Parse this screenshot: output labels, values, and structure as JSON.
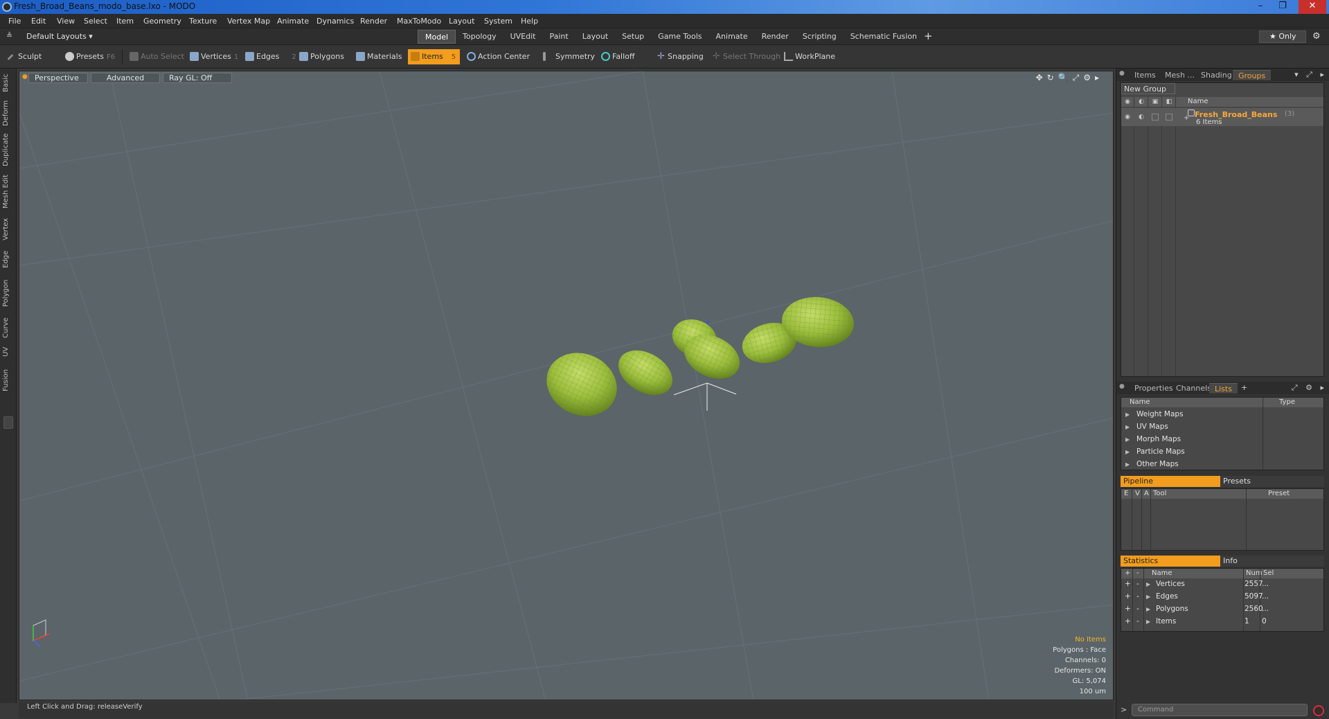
{
  "window": {
    "title": "Fresh_Broad_Beans_modo_base.lxo - MODO",
    "minimize": "–",
    "maximize": "❐",
    "close": "✕"
  },
  "menu": [
    "File",
    "Edit",
    "View",
    "Select",
    "Item",
    "Geometry",
    "Texture",
    "Vertex Map",
    "Animate",
    "Dynamics",
    "Render",
    "MaxToModo",
    "Layout",
    "System",
    "Help"
  ],
  "layoutbar": {
    "layout_label": "Default Layouts ▾",
    "tabs": [
      "Model",
      "Topology",
      "UVEdit",
      "Paint",
      "Layout",
      "Setup",
      "Game Tools",
      "Animate",
      "Render",
      "Scripting",
      "Schematic Fusion"
    ],
    "active_tab": "Model",
    "add": "+",
    "only_label": "★  Only",
    "settings": "⚙"
  },
  "toolbar": {
    "sculpt": "Sculpt",
    "presets": "Presets",
    "presets_key": "F6",
    "auto_select": "Auto Select",
    "vertices": "Vertices",
    "vertices_key": "1",
    "edges": "Edges",
    "edges_key": "2",
    "polygons": "Polygons",
    "materials": "Materials",
    "items": "Items",
    "items_key": "5",
    "action_center": "Action Center",
    "symmetry": "Symmetry",
    "falloff": "Falloff",
    "snapping": "Snapping",
    "select_through": "Select Through",
    "workplane": "WorkPlane"
  },
  "left_tabs": [
    "Basic",
    "Deform",
    "Duplicate",
    "Mesh Edit",
    "Vertex",
    "Edge",
    "Polygon",
    "Curve",
    "UV",
    "Fusion"
  ],
  "viewport": {
    "view": "Perspective",
    "shading": "Advanced",
    "raygl": "Ray GL: Off",
    "icons": "✥↻🔍⤢⚙▸",
    "info": {
      "selection": "No Items",
      "polygons": "Polygons : Face",
      "channels": "Channels: 0",
      "deformers": "Deformers: ON",
      "gl": "GL: 5,074",
      "scale": "100 um"
    }
  },
  "status": {
    "hint": "Left Click and Drag:   releaseVerify"
  },
  "right_panel": {
    "top_tabs": [
      "Items",
      "Mesh ...",
      "Shading",
      "Groups"
    ],
    "top_active": "Groups",
    "new_group": "New Group",
    "name_col": "Name",
    "group": {
      "name": "Fresh_Broad_Beans",
      "suffix": "(3)",
      "count": "6 Items"
    },
    "mid_tabs": [
      "Properties",
      "Channels",
      "Lists"
    ],
    "mid_active": "Lists",
    "lists_cols": {
      "name": "Name",
      "type": "Type"
    },
    "lists": [
      "Weight Maps",
      "UV Maps",
      "Morph Maps",
      "Particle Maps",
      "Other Maps"
    ],
    "pipeline": {
      "tab1": "Pipeline",
      "tab2": "Presets",
      "cols": [
        "E",
        "V",
        "A",
        "Tool",
        "Preset"
      ]
    },
    "statistics": {
      "tab1": "Statistics",
      "tab2": "Info",
      "cols": {
        "plus": "+",
        "minus": "-",
        "name": "Name",
        "num": "Num",
        "sel": "Sel"
      },
      "rows": [
        {
          "name": "Vertices",
          "num": "2557",
          "sel": "..."
        },
        {
          "name": "Edges",
          "num": "5097",
          "sel": "..."
        },
        {
          "name": "Polygons",
          "num": "2560",
          "sel": "..."
        },
        {
          "name": "Items",
          "num": "1",
          "sel": "0"
        }
      ]
    },
    "command_placeholder": "Command",
    "command_prompt": ">"
  },
  "colors": {
    "accent": "#f29d1e",
    "viewport_bg": "#5b6468",
    "bean_green": "#9bbd3c"
  }
}
